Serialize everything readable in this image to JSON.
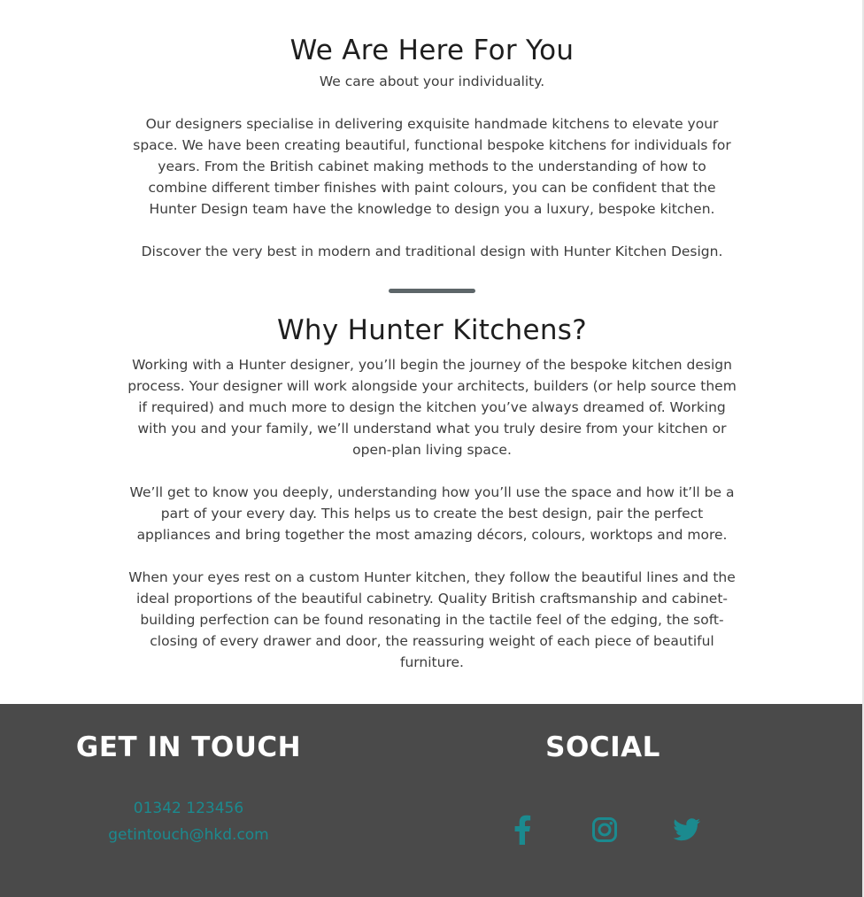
{
  "intro": {
    "title": "We Are Here For You",
    "tagline": "We care about your individuality.",
    "paragraph": "Our designers specialise in delivering exquisite handmade kitchens to elevate your space. We have been creating beautiful, functional bespoke kitchens for individuals for years. From the British cabinet making methods to the understanding of how to combine different timber finishes with paint colours, you can be confident that the Hunter Design team have the knowledge to design you a luxury, bespoke kitchen.",
    "closing": "Discover the very best in modern and traditional design with Hunter Kitchen Design."
  },
  "why": {
    "title": "Why Hunter Kitchens?",
    "paragraphs": [
      "Working with a Hunter designer, you’ll begin the journey of the bespoke kitchen design process. Your designer will work alongside your architects, builders (or help source them if required) and much more to design the kitchen you’ve always dreamed of. Working with you and your family, we’ll understand what you truly desire from your kitchen or open-plan living space.",
      "We’ll get to know you deeply, understanding how you’ll use the space and how it’ll be a part of your every day. This helps us to create the best design, pair the perfect appliances and bring together the most amazing décors, colours, worktops and more.",
      "When your eyes rest on a custom Hunter kitchen, they follow the beautiful lines and the ideal proportions of the beautiful cabinetry. Quality British craftsmanship and cabinet-building perfection can be found resonating in the tactile feel of the edging, the soft-closing of every drawer and door, the reassuring weight of each piece of beautiful furniture."
    ]
  },
  "footer": {
    "contact_heading": "GET IN TOUCH",
    "phone": "01342 123456",
    "email": "getintouch@hkd.com",
    "social_heading": "SOCIAL",
    "social_icons": [
      "facebook-icon",
      "instagram-icon",
      "twitter-icon"
    ]
  },
  "colors": {
    "footer_background": "#4a4a4a",
    "accent": "#1b8a8f",
    "divider": "#5d6669"
  }
}
